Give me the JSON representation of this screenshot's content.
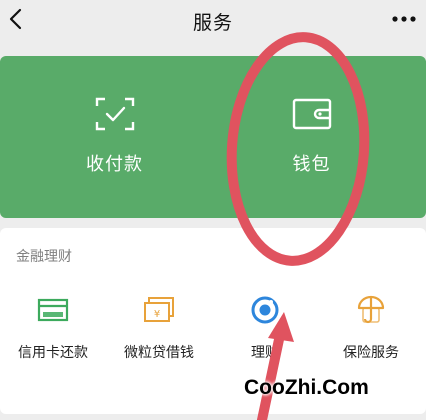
{
  "header": {
    "title": "服务"
  },
  "top_card": {
    "items": [
      {
        "label": "收付款",
        "icon": "scan-check-icon"
      },
      {
        "label": "钱包",
        "icon": "wallet-icon"
      }
    ],
    "background": "#59ab69"
  },
  "finance": {
    "section_title": "金融理财",
    "items": [
      {
        "label": "信用卡还款",
        "icon": "credit-card-icon",
        "color": "#3caa5d"
      },
      {
        "label": "微粒贷借钱",
        "icon": "cash-loan-icon",
        "color": "#e8a23a"
      },
      {
        "label": "理财",
        "icon": "wealth-management-icon",
        "color": "#2d86dc"
      },
      {
        "label": "保险服务",
        "icon": "insurance-umbrella-icon",
        "color": "#e8a23a"
      }
    ]
  },
  "annotation": {
    "ellipse_color": "#e0535f"
  },
  "watermark": {
    "text": "CooZhi.Com"
  }
}
